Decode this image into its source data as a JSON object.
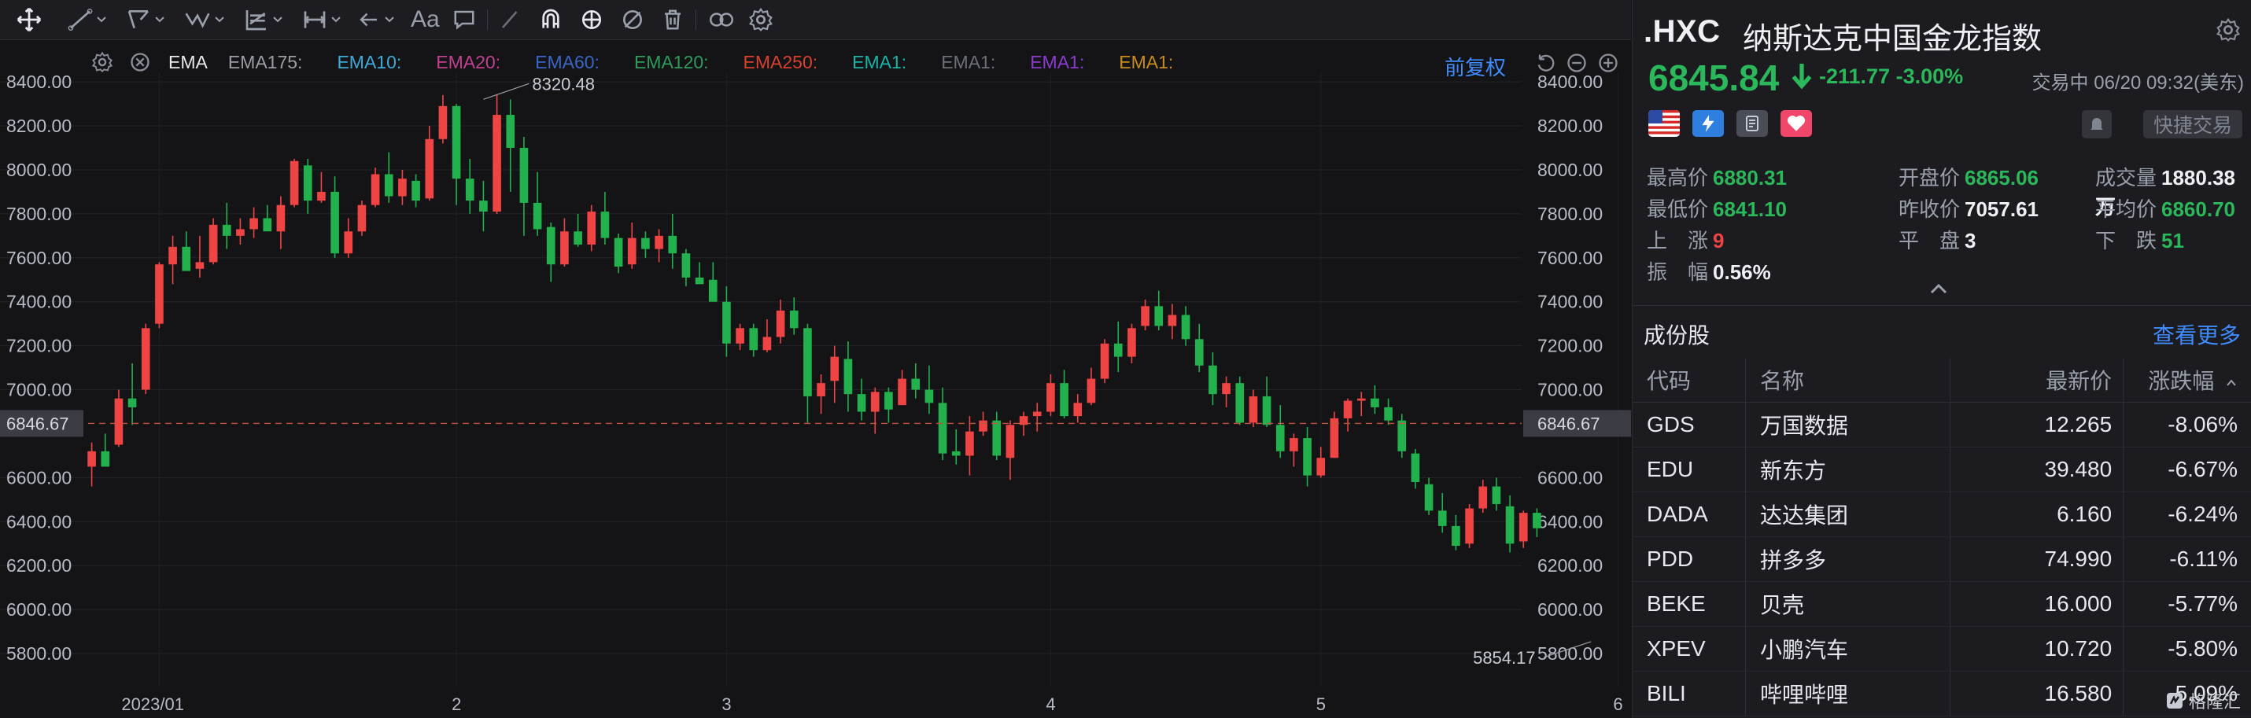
{
  "toolbar": {
    "text_tool_label": "Aa"
  },
  "indicator": {
    "name": "EMA",
    "labels": [
      {
        "text": "EMA175:",
        "color": "#9c9ea6"
      },
      {
        "text": "EMA10:",
        "color": "#3fa9d8"
      },
      {
        "text": "EMA20:",
        "color": "#c2408f"
      },
      {
        "text": "EMA60:",
        "color": "#3a66c8"
      },
      {
        "text": "EMA120:",
        "color": "#2e9c5a"
      },
      {
        "text": "EMA250:",
        "color": "#d9412a"
      },
      {
        "text": "EMA1:",
        "color": "#1ab3a8"
      },
      {
        "text": "EMA1:",
        "color": "#6c6f78"
      },
      {
        "text": "EMA1:",
        "color": "#8c3ad0"
      },
      {
        "text": "EMA1:",
        "color": "#c98b1a"
      }
    ],
    "adjust_label": "前复权"
  },
  "chart_data": {
    "type": "candlestick",
    "y_ticks": [
      "8400.00",
      "8200.00",
      "8000.00",
      "7800.00",
      "7600.00",
      "7400.00",
      "7200.00",
      "7000.00",
      "6600.00",
      "6400.00",
      "6200.00",
      "6000.00",
      "5800.00"
    ],
    "y_tick_values": [
      8400,
      8200,
      8000,
      7800,
      7600,
      7400,
      7200,
      7000,
      6600,
      6400,
      6200,
      6000,
      5800
    ],
    "ylim": [
      5650,
      8590
    ],
    "x_labels": [
      {
        "label": "2023/01",
        "index": 5
      },
      {
        "label": "2",
        "index": 27
      },
      {
        "label": "3",
        "index": 47
      },
      {
        "label": "4",
        "index": 71
      },
      {
        "label": "5",
        "index": 91
      },
      {
        "label": "6",
        "index": 113
      }
    ],
    "current_price": 6846.67,
    "current_price_label": "6846.67",
    "high_annotation": {
      "label": "8320.48",
      "index": 29,
      "value": 8320.48
    },
    "low_annotation": {
      "label": "5854.17",
      "index": 111,
      "value": 5854.17
    },
    "up_color": "#ef4444",
    "down_color": "#22b14c",
    "candles": [
      [
        6650,
        6760,
        6560,
        6720
      ],
      [
        6720,
        6800,
        6660,
        6650
      ],
      [
        6750,
        7000,
        6740,
        6960
      ],
      [
        6960,
        7120,
        6840,
        6920
      ],
      [
        7000,
        7300,
        6980,
        7280
      ],
      [
        7300,
        7580,
        7280,
        7570
      ],
      [
        7570,
        7700,
        7480,
        7650
      ],
      [
        7650,
        7720,
        7550,
        7540
      ],
      [
        7550,
        7700,
        7510,
        7580
      ],
      [
        7580,
        7780,
        7570,
        7750
      ],
      [
        7750,
        7850,
        7640,
        7700
      ],
      [
        7700,
        7780,
        7660,
        7730
      ],
      [
        7730,
        7830,
        7690,
        7780
      ],
      [
        7780,
        7840,
        7750,
        7720
      ],
      [
        7720,
        7880,
        7640,
        7840
      ],
      [
        7840,
        8050,
        7830,
        8040
      ],
      [
        8020,
        8050,
        7800,
        7860
      ],
      [
        7860,
        7990,
        7850,
        7900
      ],
      [
        7900,
        7970,
        7600,
        7620
      ],
      [
        7620,
        7780,
        7600,
        7720
      ],
      [
        7720,
        7860,
        7700,
        7840
      ],
      [
        7840,
        8010,
        7830,
        7980
      ],
      [
        7980,
        8080,
        7850,
        7880
      ],
      [
        7880,
        8000,
        7840,
        7960
      ],
      [
        7950,
        7980,
        7830,
        7860
      ],
      [
        7870,
        8200,
        7860,
        8140
      ],
      [
        8140,
        8340,
        8120,
        8290
      ],
      [
        8290,
        8300,
        7840,
        7960
      ],
      [
        7960,
        8050,
        7800,
        7860
      ],
      [
        7860,
        7950,
        7720,
        7810
      ],
      [
        7810,
        8340,
        7800,
        8250
      ],
      [
        8250,
        8320,
        7900,
        8100
      ],
      [
        8100,
        8150,
        7700,
        7850
      ],
      [
        7850,
        7990,
        7700,
        7730
      ],
      [
        7740,
        7760,
        7490,
        7570
      ],
      [
        7570,
        7780,
        7560,
        7720
      ],
      [
        7720,
        7800,
        7650,
        7660
      ],
      [
        7660,
        7840,
        7630,
        7810
      ],
      [
        7810,
        7900,
        7660,
        7690
      ],
      [
        7690,
        7710,
        7530,
        7560
      ],
      [
        7570,
        7760,
        7550,
        7690
      ],
      [
        7690,
        7720,
        7600,
        7640
      ],
      [
        7640,
        7730,
        7580,
        7700
      ],
      [
        7700,
        7800,
        7550,
        7620
      ],
      [
        7620,
        7640,
        7470,
        7510
      ],
      [
        7510,
        7580,
        7490,
        7480
      ],
      [
        7500,
        7580,
        7410,
        7400
      ],
      [
        7400,
        7470,
        7150,
        7210
      ],
      [
        7210,
        7300,
        7180,
        7280
      ],
      [
        7280,
        7300,
        7150,
        7180
      ],
      [
        7180,
        7320,
        7170,
        7240
      ],
      [
        7240,
        7410,
        7210,
        7360
      ],
      [
        7360,
        7420,
        7250,
        7280
      ],
      [
        7280,
        7300,
        6850,
        6970
      ],
      [
        6970,
        7070,
        6890,
        7030
      ],
      [
        7040,
        7200,
        6940,
        7150
      ],
      [
        7140,
        7220,
        6900,
        6980
      ],
      [
        6980,
        7050,
        6860,
        6900
      ],
      [
        6900,
        7010,
        6800,
        6990
      ],
      [
        6990,
        7010,
        6850,
        6910
      ],
      [
        6930,
        7090,
        6930,
        7050
      ],
      [
        7050,
        7120,
        6960,
        7000
      ],
      [
        7000,
        7110,
        6890,
        6940
      ],
      [
        6940,
        7010,
        6680,
        6710
      ],
      [
        6720,
        6820,
        6660,
        6700
      ],
      [
        6700,
        6880,
        6610,
        6810
      ],
      [
        6810,
        6900,
        6790,
        6860
      ],
      [
        6860,
        6900,
        6680,
        6700
      ],
      [
        6690,
        6860,
        6590,
        6840
      ],
      [
        6840,
        6900,
        6790,
        6880
      ],
      [
        6880,
        6940,
        6810,
        6900
      ],
      [
        6900,
        7070,
        6880,
        7030
      ],
      [
        7030,
        7090,
        6870,
        6880
      ],
      [
        6880,
        6980,
        6850,
        6940
      ],
      [
        6940,
        7100,
        6930,
        7050
      ],
      [
        7050,
        7230,
        7030,
        7210
      ],
      [
        7210,
        7310,
        7080,
        7150
      ],
      [
        7150,
        7300,
        7120,
        7280
      ],
      [
        7290,
        7410,
        7270,
        7380
      ],
      [
        7380,
        7450,
        7270,
        7290
      ],
      [
        7290,
        7390,
        7230,
        7340
      ],
      [
        7340,
        7380,
        7200,
        7230
      ],
      [
        7230,
        7300,
        7080,
        7110
      ],
      [
        7110,
        7170,
        6930,
        6980
      ],
      [
        6980,
        7060,
        6920,
        7030
      ],
      [
        7030,
        7060,
        6840,
        6850
      ],
      [
        6850,
        7000,
        6830,
        6970
      ],
      [
        6970,
        7060,
        6830,
        6840
      ],
      [
        6840,
        6930,
        6690,
        6720
      ],
      [
        6720,
        6800,
        6650,
        6780
      ],
      [
        6780,
        6830,
        6560,
        6610
      ],
      [
        6610,
        6740,
        6600,
        6690
      ],
      [
        6690,
        6900,
        6690,
        6870
      ],
      [
        6870,
        6960,
        6810,
        6950
      ],
      [
        6950,
        6990,
        6880,
        6960
      ],
      [
        6960,
        7020,
        6890,
        6920
      ],
      [
        6920,
        6960,
        6840,
        6860
      ],
      [
        6860,
        6890,
        6690,
        6720
      ],
      [
        6710,
        6730,
        6550,
        6580
      ],
      [
        6570,
        6600,
        6430,
        6450
      ],
      [
        6450,
        6530,
        6350,
        6380
      ],
      [
        6380,
        6430,
        6270,
        6290
      ],
      [
        6300,
        6480,
        6280,
        6460
      ],
      [
        6460,
        6590,
        6440,
        6560
      ],
      [
        6560,
        6600,
        6450,
        6480
      ],
      [
        6470,
        6520,
        6260,
        6300
      ],
      [
        6310,
        6450,
        6280,
        6440
      ],
      [
        6440,
        6460,
        6330,
        6370
      ]
    ]
  },
  "panel": {
    "symbol": ".HXC",
    "name": "纳斯达克中国金龙指数",
    "price": "6845.84",
    "change": "-211.77 -3.00%",
    "status": "交易中 06/20 09:32(美东)",
    "quick_trade": "快捷交易",
    "stats": [
      {
        "label": "最高价",
        "value": "6880.31",
        "color": "green"
      },
      {
        "label": "开盘价",
        "value": "6865.06",
        "color": "green"
      },
      {
        "label": "成交量",
        "value": "1880.38万",
        "color": "white"
      },
      {
        "label": "最低价",
        "value": "6841.10",
        "color": "green"
      },
      {
        "label": "昨收价",
        "value": "7057.61",
        "color": "white"
      },
      {
        "label": "平均价",
        "value": "6860.70",
        "color": "green"
      },
      {
        "label": "上　涨",
        "value": "9",
        "color": "red"
      },
      {
        "label": "平　盘",
        "value": "3",
        "color": "white"
      },
      {
        "label": "下　跌",
        "value": "51",
        "color": "green"
      },
      {
        "label": "振　幅",
        "value": "0.56%",
        "color": "white"
      }
    ],
    "constituents_title": "成份股",
    "more_label": "查看更多",
    "columns": [
      "代码",
      "名称",
      "最新价",
      "涨跌幅"
    ],
    "rows": [
      {
        "code": "GDS",
        "name": "万国数据",
        "price": "12.265",
        "chg": "-8.06%"
      },
      {
        "code": "EDU",
        "name": "新东方",
        "price": "39.480",
        "chg": "-6.67%"
      },
      {
        "code": "DADA",
        "name": "达达集团",
        "price": "6.160",
        "chg": "-6.24%"
      },
      {
        "code": "PDD",
        "name": "拼多多",
        "price": "74.990",
        "chg": "-6.11%"
      },
      {
        "code": "BEKE",
        "name": "贝壳",
        "price": "16.000",
        "chg": "-5.77%"
      },
      {
        "code": "XPEV",
        "name": "小鹏汽车",
        "price": "10.720",
        "chg": "-5.80%"
      },
      {
        "code": "BILI",
        "name": "哔哩哔哩",
        "price": "16.580",
        "chg": "-5.09%"
      }
    ],
    "watermark": "格隆汇"
  }
}
